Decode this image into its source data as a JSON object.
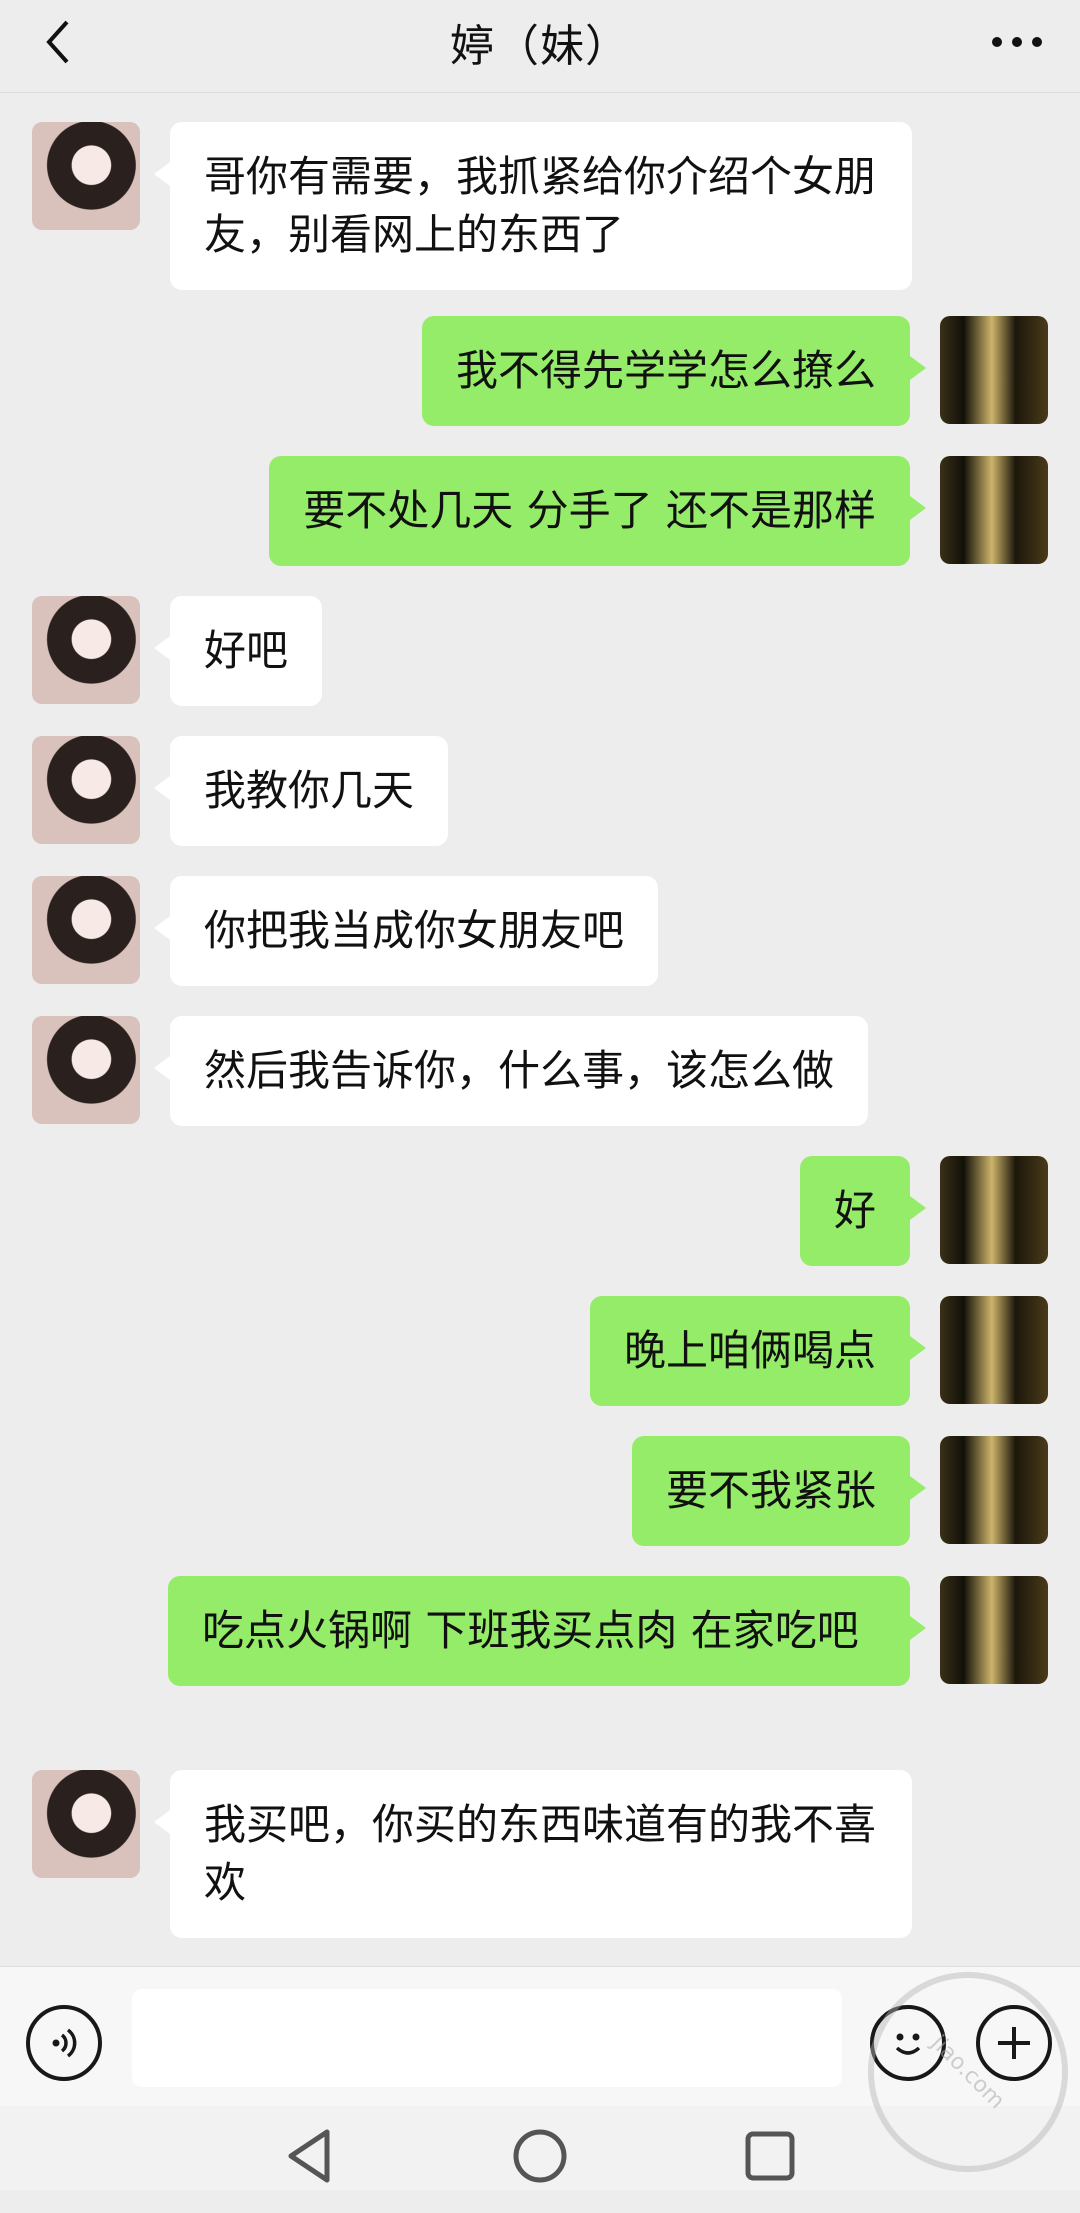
{
  "header": {
    "title": "婷（妹）"
  },
  "messages": [
    {
      "side": "left",
      "text": "哥你有需要，我抓紧给你介绍个女朋友，别看网上的东西了"
    },
    {
      "side": "right",
      "text": "我不得先学学怎么撩么"
    },
    {
      "side": "right",
      "text": "要不处几天 分手了 还不是那样"
    },
    {
      "side": "left",
      "text": "好吧"
    },
    {
      "side": "left",
      "text": "我教你几天"
    },
    {
      "side": "left",
      "text": "你把我当成你女朋友吧"
    },
    {
      "side": "left",
      "text": "然后我告诉你，什么事，该怎么做"
    },
    {
      "side": "right",
      "text": "好"
    },
    {
      "side": "right",
      "text": "晚上咱俩喝点"
    },
    {
      "side": "right",
      "text": "要不我紧张"
    },
    {
      "side": "right",
      "text": "吃点火锅啊 下班我买点肉 在家吃吧"
    },
    {
      "side": "left",
      "text": "我买吧，你买的东西味道有的我不喜欢"
    }
  ],
  "input": {
    "value": ""
  },
  "watermark": {
    "text": "jiao.com"
  },
  "colors": {
    "background": "#ededed",
    "bubble_me": "#95ec69",
    "bubble_other": "#ffffff"
  }
}
